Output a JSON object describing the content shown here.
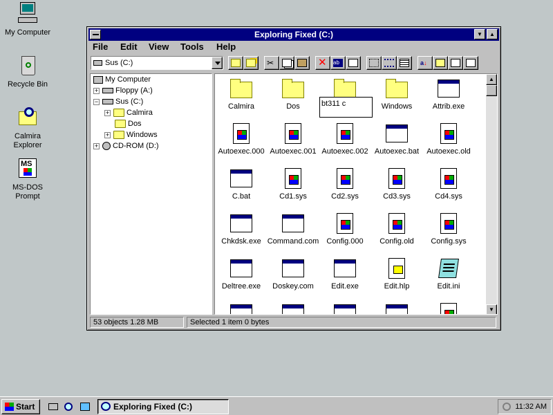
{
  "desktop": {
    "icons": [
      {
        "label": "My Computer"
      },
      {
        "label": "Recycle Bin"
      },
      {
        "label": "Calmira Explorer"
      },
      {
        "label": "MS-DOS Prompt"
      }
    ]
  },
  "window": {
    "title": "Exploring Fixed (C:)",
    "menu": [
      "File",
      "Edit",
      "View",
      "Tools",
      "Help"
    ],
    "drive_combo": "Sus (C:)",
    "tree": [
      {
        "label": "My Computer"
      },
      {
        "label": "Floppy (A:)"
      },
      {
        "label": "Sus (C:)"
      },
      {
        "label": "Calmira"
      },
      {
        "label": "Dos"
      },
      {
        "label": "Windows"
      },
      {
        "label": "CD-ROM (D:)"
      }
    ],
    "files": [
      {
        "name": "Calmira",
        "icon": "folder-icon"
      },
      {
        "name": "Dos",
        "icon": "folder-icon"
      },
      {
        "name": "",
        "icon": "folder-icon"
      },
      {
        "name": "Windows",
        "icon": "folder-icon"
      },
      {
        "name": "Attrib.exe",
        "icon": "exe-icon"
      },
      {
        "name": "Autoexec.000",
        "icon": "doc-icon"
      },
      {
        "name": "Autoexec.001",
        "icon": "doc-icon"
      },
      {
        "name": "Autoexec.002",
        "icon": "doc-icon"
      },
      {
        "name": "Autoexec.bat",
        "icon": "exe-icon"
      },
      {
        "name": "Autoexec.old",
        "icon": "doc-icon"
      },
      {
        "name": "C.bat",
        "icon": "exe-icon"
      },
      {
        "name": "Cd1.sys",
        "icon": "doc-icon"
      },
      {
        "name": "Cd2.sys",
        "icon": "doc-icon"
      },
      {
        "name": "Cd3.sys",
        "icon": "doc-icon"
      },
      {
        "name": "Cd4.sys",
        "icon": "doc-icon"
      },
      {
        "name": "Chkdsk.exe",
        "icon": "exe-icon"
      },
      {
        "name": "Command.com",
        "icon": "exe-icon"
      },
      {
        "name": "Config.000",
        "icon": "doc-icon"
      },
      {
        "name": "Config.old",
        "icon": "doc-icon"
      },
      {
        "name": "Config.sys",
        "icon": "doc-icon"
      },
      {
        "name": "Deltree.exe",
        "icon": "exe-icon"
      },
      {
        "name": "Doskey.com",
        "icon": "exe-icon"
      },
      {
        "name": "Edit.exe",
        "icon": "exe-icon"
      },
      {
        "name": "Edit.hlp",
        "icon": "help-icon"
      },
      {
        "name": "Edit.ini",
        "icon": "ini-icon"
      }
    ],
    "rename_value": "bt311 c",
    "status_left": "53 objects  1.28 MB",
    "status_right": "Selected 1 item  0 bytes"
  },
  "taskbar": {
    "start": "Start",
    "task_button": "Exploring Fixed (C:)",
    "clock": "11:32 AM"
  }
}
